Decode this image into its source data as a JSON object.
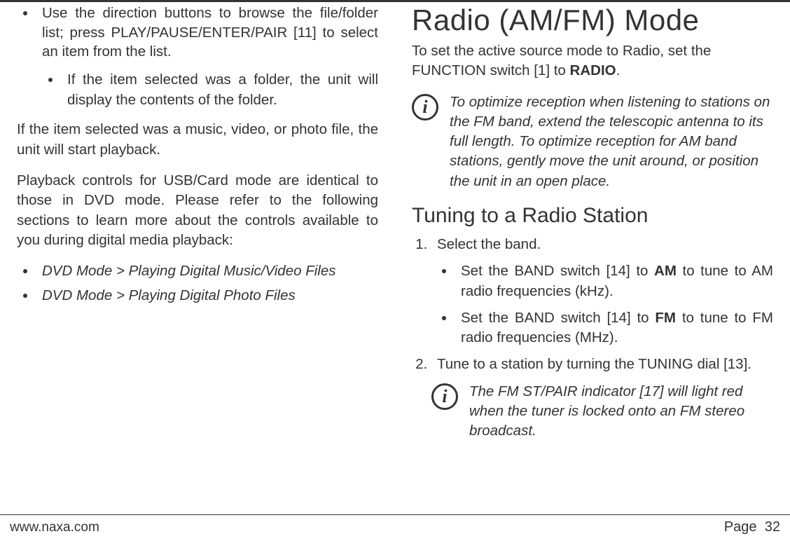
{
  "left": {
    "bullet1": "Use the direction buttons to browse the file/folder list; press PLAY/PAUSE/ENTER/PAIR [11] to select an item from the list.",
    "sub_bullet": "If the item selected was a folder, the unit will display the contents of the folder.",
    "para1": "If the item selected was a music, video, or photo file, the unit will start playback.",
    "para2": "Playback controls for USB/Card mode are identical to those in DVD mode. Please refer to the following sections to learn more about the controls available to you during digital media playback:",
    "ref1": "DVD Mode > Playing Digital Music/Video Files",
    "ref2": "DVD Mode > Playing Digital Photo Files"
  },
  "right": {
    "title": "Radio (AM/FM) Mode",
    "intro_pre": "To set the active source mode to Radio, set the FUNCTION switch [1] to ",
    "intro_bold": "RADIO",
    "intro_post": ".",
    "info1": "To optimize reception when listening to stations on the FM band, extend the telescopic antenna to its full length. To optimize reception for AM band stations, gently move the unit around, or position the unit in an open place.",
    "subhead": "Tuning to a Radio Station",
    "step1": "Select the band.",
    "step1a_pre": "Set the BAND switch [14] to ",
    "step1a_bold": "AM",
    "step1a_post": " to tune to AM radio frequencies (kHz).",
    "step1b_pre": "Set the BAND switch [14] to ",
    "step1b_bold": "FM",
    "step1b_post": " to tune to FM radio frequencies (MHz).",
    "step2": "Tune to a station by turning the TUNING dial [13].",
    "info2": "The FM ST/PAIR indicator [17] will light red when the tuner is locked onto an FM stereo broadcast."
  },
  "footer": {
    "url": "www.naxa.com",
    "page_label": "Page",
    "page_num": "32"
  },
  "icons": {
    "info_glyph": "i"
  }
}
